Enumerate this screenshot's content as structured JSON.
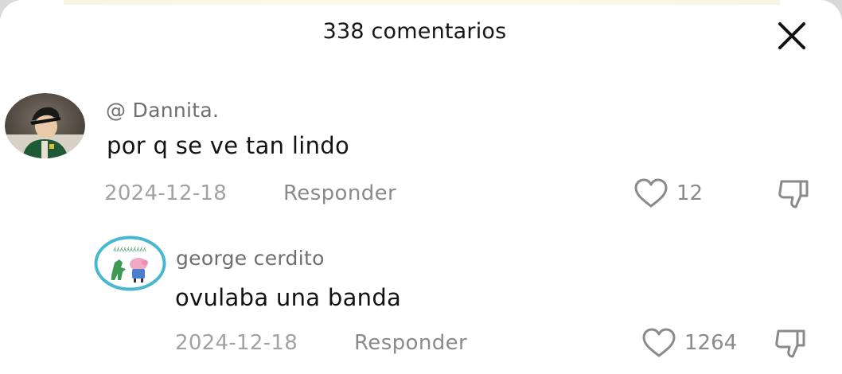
{
  "header": {
    "title": "338 comentarios",
    "close_icon": "close-icon"
  },
  "comments": [
    {
      "username": "@ Dannita.",
      "text": "por q se ve tan lindo",
      "date": "2024-12-18",
      "reply_label": "Responder",
      "likes": "12",
      "avatar_icon": "user-avatar-photo"
    },
    {
      "username": "george cerdito",
      "text": "ovulaba una banda",
      "date": "2024-12-18",
      "reply_label": "Responder",
      "likes": "1264",
      "avatar_icon": "cartoon-pig-dinosaur-avatar"
    }
  ],
  "colors": {
    "text_primary": "#121212",
    "text_secondary": "#6e6e6e",
    "text_muted": "#a2a2a2",
    "avatar_ring": "#48b8d0",
    "background": "#ffffff"
  }
}
